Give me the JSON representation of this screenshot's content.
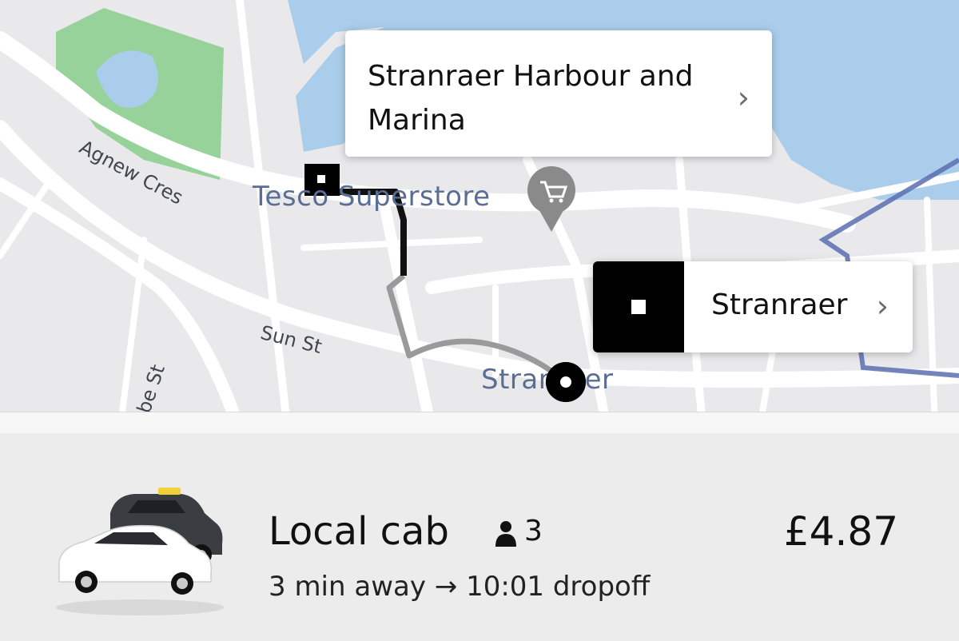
{
  "map": {
    "road_labels": {
      "agnew": "Agnew Cres",
      "sun": "Sun St",
      "partial": "be St"
    },
    "place_labels": {
      "tesco": "Tesco Superstore",
      "town": "Stranraer"
    },
    "destination_callout": {
      "label": "Stranraer Harbour and Marina",
      "chevron": "›"
    },
    "origin_callout": {
      "label": "Stranraer",
      "chevron": "›"
    },
    "colors": {
      "water": "#a9cdea",
      "park": "#96d29a",
      "route_walk": "#111111",
      "route_drive": "#9a9a9a",
      "boundary": "#5b6fb0"
    }
  },
  "ride": {
    "name": "Local cab",
    "seat_icon": "person-icon",
    "seats": "3",
    "eta": "3 min away → 10:01 dropoff",
    "price": "£4.87"
  }
}
